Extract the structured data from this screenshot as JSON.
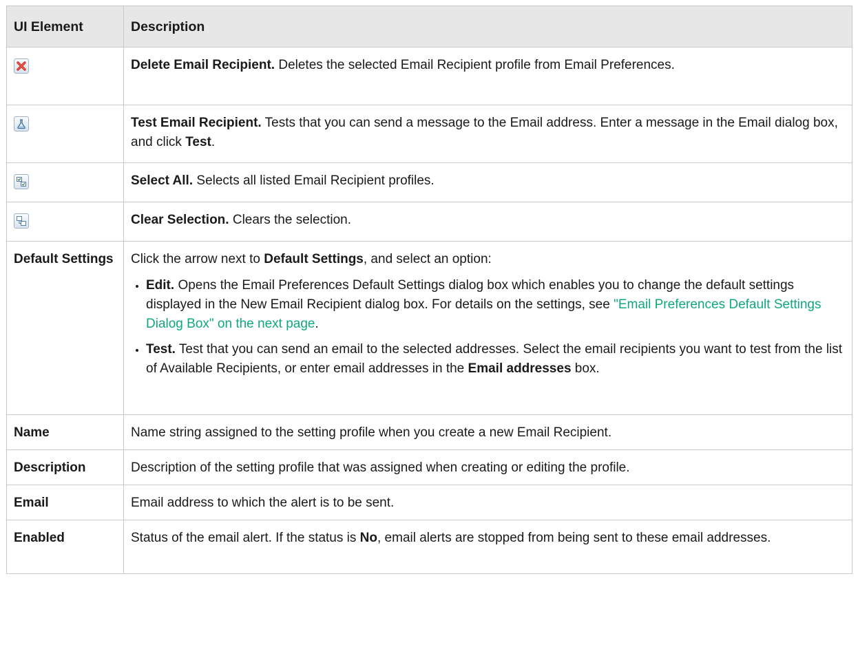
{
  "header": {
    "col1": "UI Element",
    "col2": "Description"
  },
  "rows": {
    "delete": {
      "icon": "delete-red-x-icon",
      "title": "Delete Email Recipient.",
      "text": " Deletes the selected Email Recipient profile from Email Preferences."
    },
    "test": {
      "icon": "flask-test-icon",
      "title": "Test Email Recipient.",
      "text_before": " Tests that you can send a message to the Email address. Enter a message in the Email dialog box, and click ",
      "bold": "Test",
      "text_after": "."
    },
    "select_all": {
      "icon": "select-all-icon",
      "title": "Select All.",
      "text": " Selects all listed Email Recipient profiles."
    },
    "clear": {
      "icon": "clear-selection-icon",
      "title": "Clear Selection.",
      "text": " Clears the selection."
    },
    "default_settings": {
      "label": "Default Settings",
      "intro_before": "Click the arrow next to ",
      "intro_bold": "Default Settings",
      "intro_after": ", and select an option:",
      "edit_title": "Edit.",
      "edit_text": " Opens the Email Preferences Default Settings dialog box which enables you to change the default settings displayed in the New Email Recipient dialog box. For details on the settings, see ",
      "edit_link": "\"Email Preferences Default Settings Dialog Box\" on the next page",
      "edit_end": ".",
      "test_title": "Test.",
      "test_text": " Test that you can send an email to the selected addresses. Select the email recipients you want to test from the list of Available Recipients, or enter email addresses in the ",
      "test_bold": "Email addresses",
      "test_end": " box."
    },
    "name": {
      "label": "Name",
      "text": "Name string assigned to the setting profile when you create a new Email Recipient."
    },
    "description": {
      "label": "Description",
      "text": "Description of the setting profile that was assigned when creating or editing the profile."
    },
    "email": {
      "label": "Email",
      "text": "Email address to which the alert is to be sent."
    },
    "enabled": {
      "label": "Enabled",
      "text_before": "Status of the email alert. If the status is ",
      "bold": "No",
      "text_after": ", email alerts are stopped from being sent to these email addresses."
    }
  },
  "colors": {
    "header_bg": "#e7e7e7",
    "border": "#c9c9c9",
    "link": "#11a77e"
  }
}
